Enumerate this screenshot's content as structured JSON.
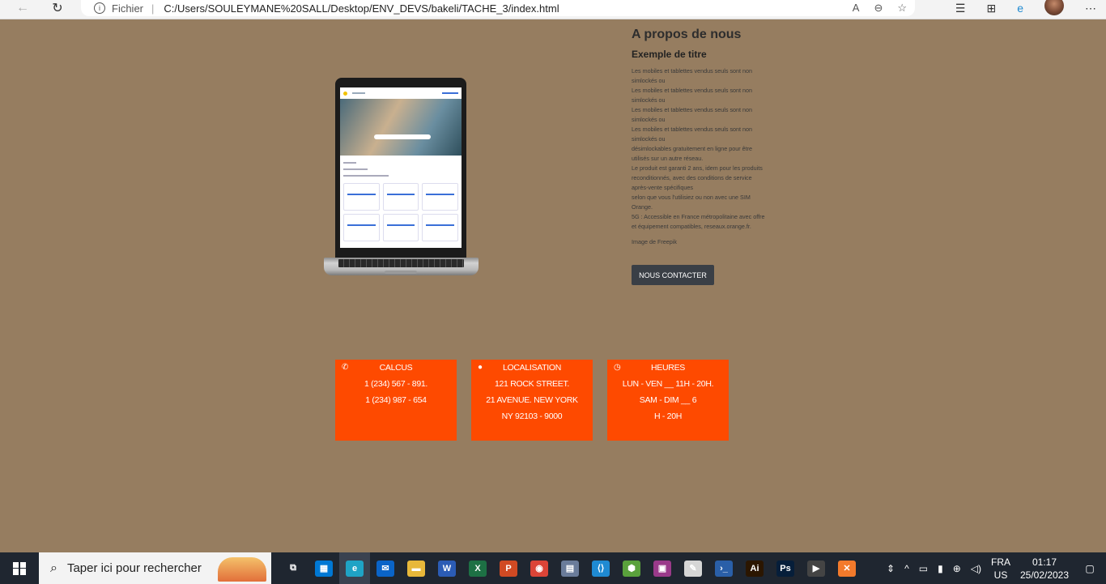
{
  "browser": {
    "scheme": "Fichier",
    "url": "C:/Users/SOULEYMANE%20SALL/Desktop/ENV_DEVS/bakeli/TACHE_3/index.html"
  },
  "about": {
    "title": "A propos de nous",
    "subtitle": "Exemple de titre",
    "lines": [
      "Les mobiles et tablettes vendus seuls sont non",
      "simlockés ou",
      "Les mobiles et tablettes vendus seuls sont non",
      "simlockés ou",
      "Les mobiles et tablettes vendus seuls sont non",
      "simlockés ou",
      "Les mobiles et tablettes vendus seuls sont non",
      "simlockés ou",
      "désimlockables gratuitement en ligne pour être",
      "utilisés sur un autre réseau.",
      "Le produit est garanti 2 ans, idem pour les produits",
      "reconditionnés, avec des conditions de service",
      "après-vente spécifiques",
      "selon que vous l'utilisiez ou non avec une SIM",
      "Orange.",
      "5G : Accessible en France métropolitaine avec offre",
      "et équipement compatibles, reseaux.orange.fr."
    ],
    "credit": "Image de Freepik",
    "button": "NOUS CONTACTER"
  },
  "cards": [
    {
      "icon": "phone-icon",
      "glyph": "✆",
      "title": "CALCUS",
      "lines": [
        "1 (234) 567 - 891.",
        "1 (234) 987 - 654"
      ]
    },
    {
      "icon": "map-pin-icon",
      "glyph": "●",
      "title": "LOCALISATION",
      "lines": [
        "121 ROCK STREET.",
        "21 AVENUE. NEW YORK",
        "NY 92103 - 9000"
      ]
    },
    {
      "icon": "clock-icon",
      "glyph": "◷",
      "title": "HEURES",
      "lines": [
        "LUN - VEN __ 11H - 20H.",
        "SAM - DIM __ 6",
        "H - 20H"
      ]
    }
  ],
  "taskbar": {
    "search_placeholder": "Taper ici pour rechercher",
    "lang_top": "FRA",
    "lang_bottom": "US",
    "time": "01:17",
    "date": "25/02/2023",
    "apps": [
      {
        "name": "task-view-icon",
        "label": "⧉",
        "color": ""
      },
      {
        "name": "ms-store-icon",
        "label": "▦",
        "color": "#0078d4"
      },
      {
        "name": "edge-icon",
        "label": "e",
        "color": "#1fa3c5"
      },
      {
        "name": "mail-icon",
        "label": "✉",
        "color": "#0a64c8"
      },
      {
        "name": "file-explorer-icon",
        "label": "▬",
        "color": "#e8b83a"
      },
      {
        "name": "word-icon",
        "label": "W",
        "color": "#2b5cb5"
      },
      {
        "name": "excel-icon",
        "label": "X",
        "color": "#1d7044"
      },
      {
        "name": "powerpoint-icon",
        "label": "P",
        "color": "#d04a23"
      },
      {
        "name": "chrome-icon",
        "label": "◉",
        "color": "#db4437"
      },
      {
        "name": "printer-app-icon",
        "label": "▤",
        "color": "#6a7c9a"
      },
      {
        "name": "vscode-icon",
        "label": "⟨⟩",
        "color": "#1f8ad2"
      },
      {
        "name": "nodejs-icon",
        "label": "⬢",
        "color": "#5aa13c"
      },
      {
        "name": "winrar-icon",
        "label": "▣",
        "color": "#9a3a8a"
      },
      {
        "name": "paint-icon",
        "label": "✎",
        "color": "#d6d6d6"
      },
      {
        "name": "powershell-icon",
        "label": "›_",
        "color": "#2a5fa8"
      },
      {
        "name": "illustrator-icon",
        "label": "Ai",
        "color": "#2b1600"
      },
      {
        "name": "photoshop-icon",
        "label": "Ps",
        "color": "#061e3a"
      },
      {
        "name": "media-player-icon",
        "label": "▶",
        "color": "#444"
      },
      {
        "name": "xampp-icon",
        "label": "✕",
        "color": "#f37a2b"
      }
    ]
  }
}
